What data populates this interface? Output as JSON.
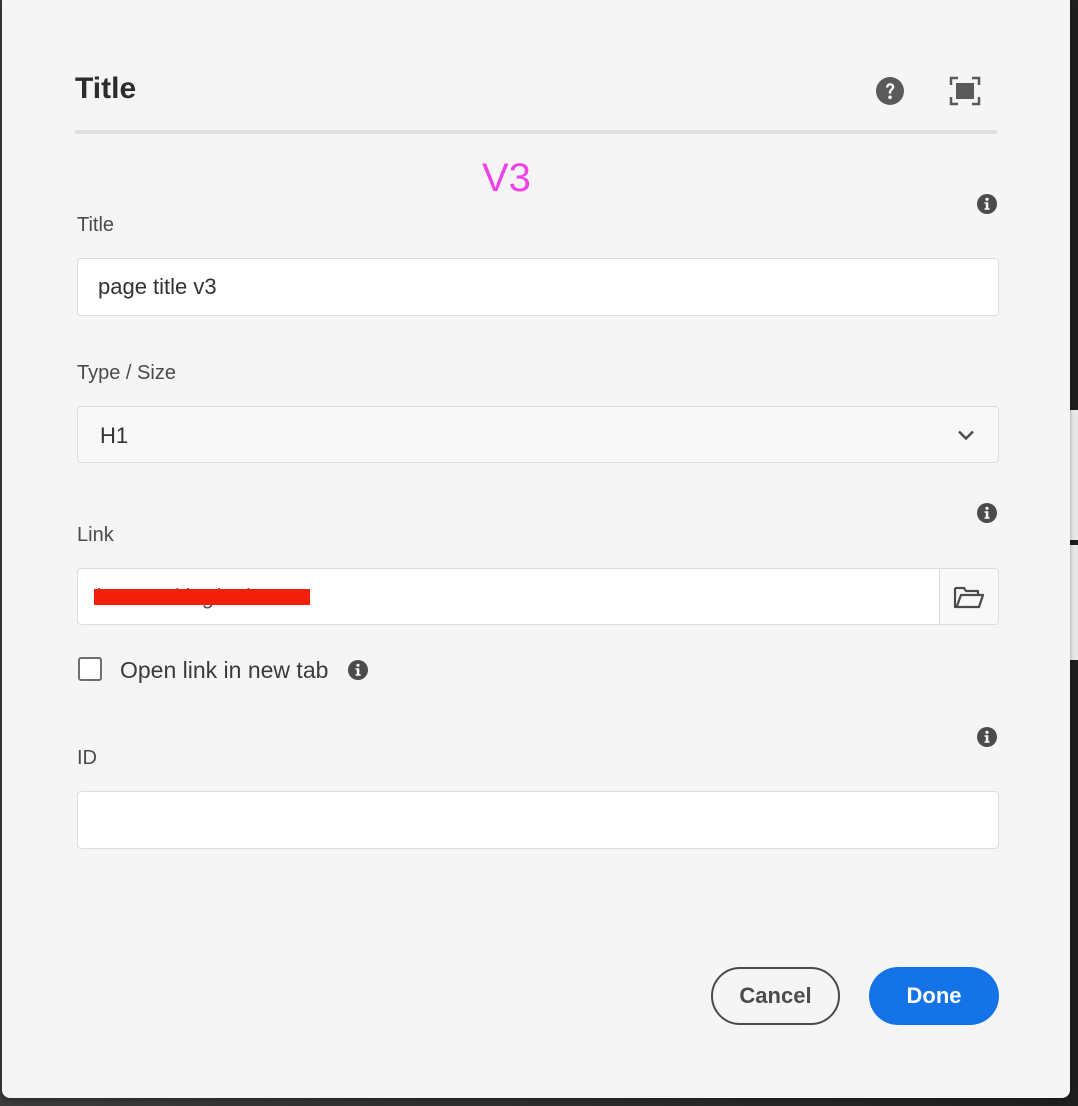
{
  "dialog": {
    "title": "Title",
    "version_tag": "V3",
    "help_icon": "help-circle-icon",
    "fullscreen_icon": "fullscreen-icon"
  },
  "fields": {
    "title": {
      "label": "Title",
      "value": "page title v3"
    },
    "type_size": {
      "label": "Type / Size",
      "selected": "H1"
    },
    "link": {
      "label": "Link",
      "value": "/content/dsg/us/en",
      "redacted": true,
      "browse_icon": "folder-open-icon"
    },
    "open_new_tab": {
      "label": "Open link in new tab",
      "checked": false
    },
    "id": {
      "label": "ID",
      "value": ""
    }
  },
  "actions": {
    "cancel_label": "Cancel",
    "done_label": "Done"
  },
  "colors": {
    "accent": "#1473e6",
    "version_tag": "#ee44e6",
    "redaction": "#f21f0a"
  }
}
